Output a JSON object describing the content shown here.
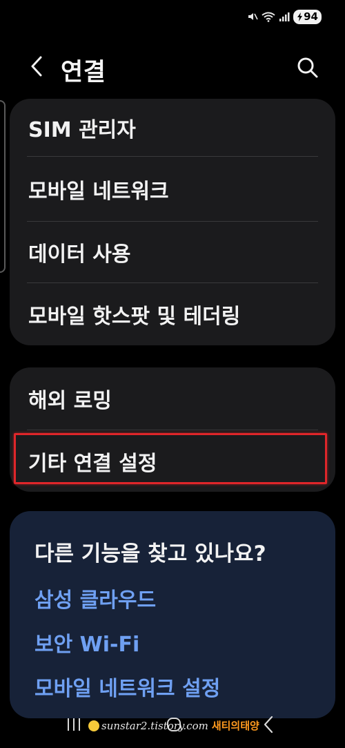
{
  "status_bar": {
    "battery_level": "94",
    "icons": [
      "mute-icon",
      "wifi-icon",
      "signal-icon",
      "battery-charging-icon"
    ]
  },
  "header": {
    "title": "연결",
    "icons": [
      "back-arrow-icon",
      "search-icon"
    ]
  },
  "groups": [
    {
      "items": [
        {
          "label": "SIM 관리자"
        },
        {
          "label": "모바일 네트워크"
        },
        {
          "label": "데이터 사용"
        },
        {
          "label": "모바일 핫스팟 및 테더링"
        }
      ]
    },
    {
      "items": [
        {
          "label": "해외 로밍"
        },
        {
          "label": "기타 연결 설정",
          "highlighted": true
        }
      ]
    }
  ],
  "suggestions": {
    "title": "다른 기능을 찾고 있나요?",
    "links": [
      "삼성 클라우드",
      "보안 Wi-Fi",
      "모바일 네트워크 설정"
    ]
  },
  "watermark": {
    "url": "sunstar2.tistory.com",
    "brand": "새티의태양"
  },
  "colors": {
    "background": "#000000",
    "card": "#1b1b1d",
    "suggestion_card": "#172238",
    "link": "#6fa0f2",
    "highlight": "#e0262a"
  }
}
